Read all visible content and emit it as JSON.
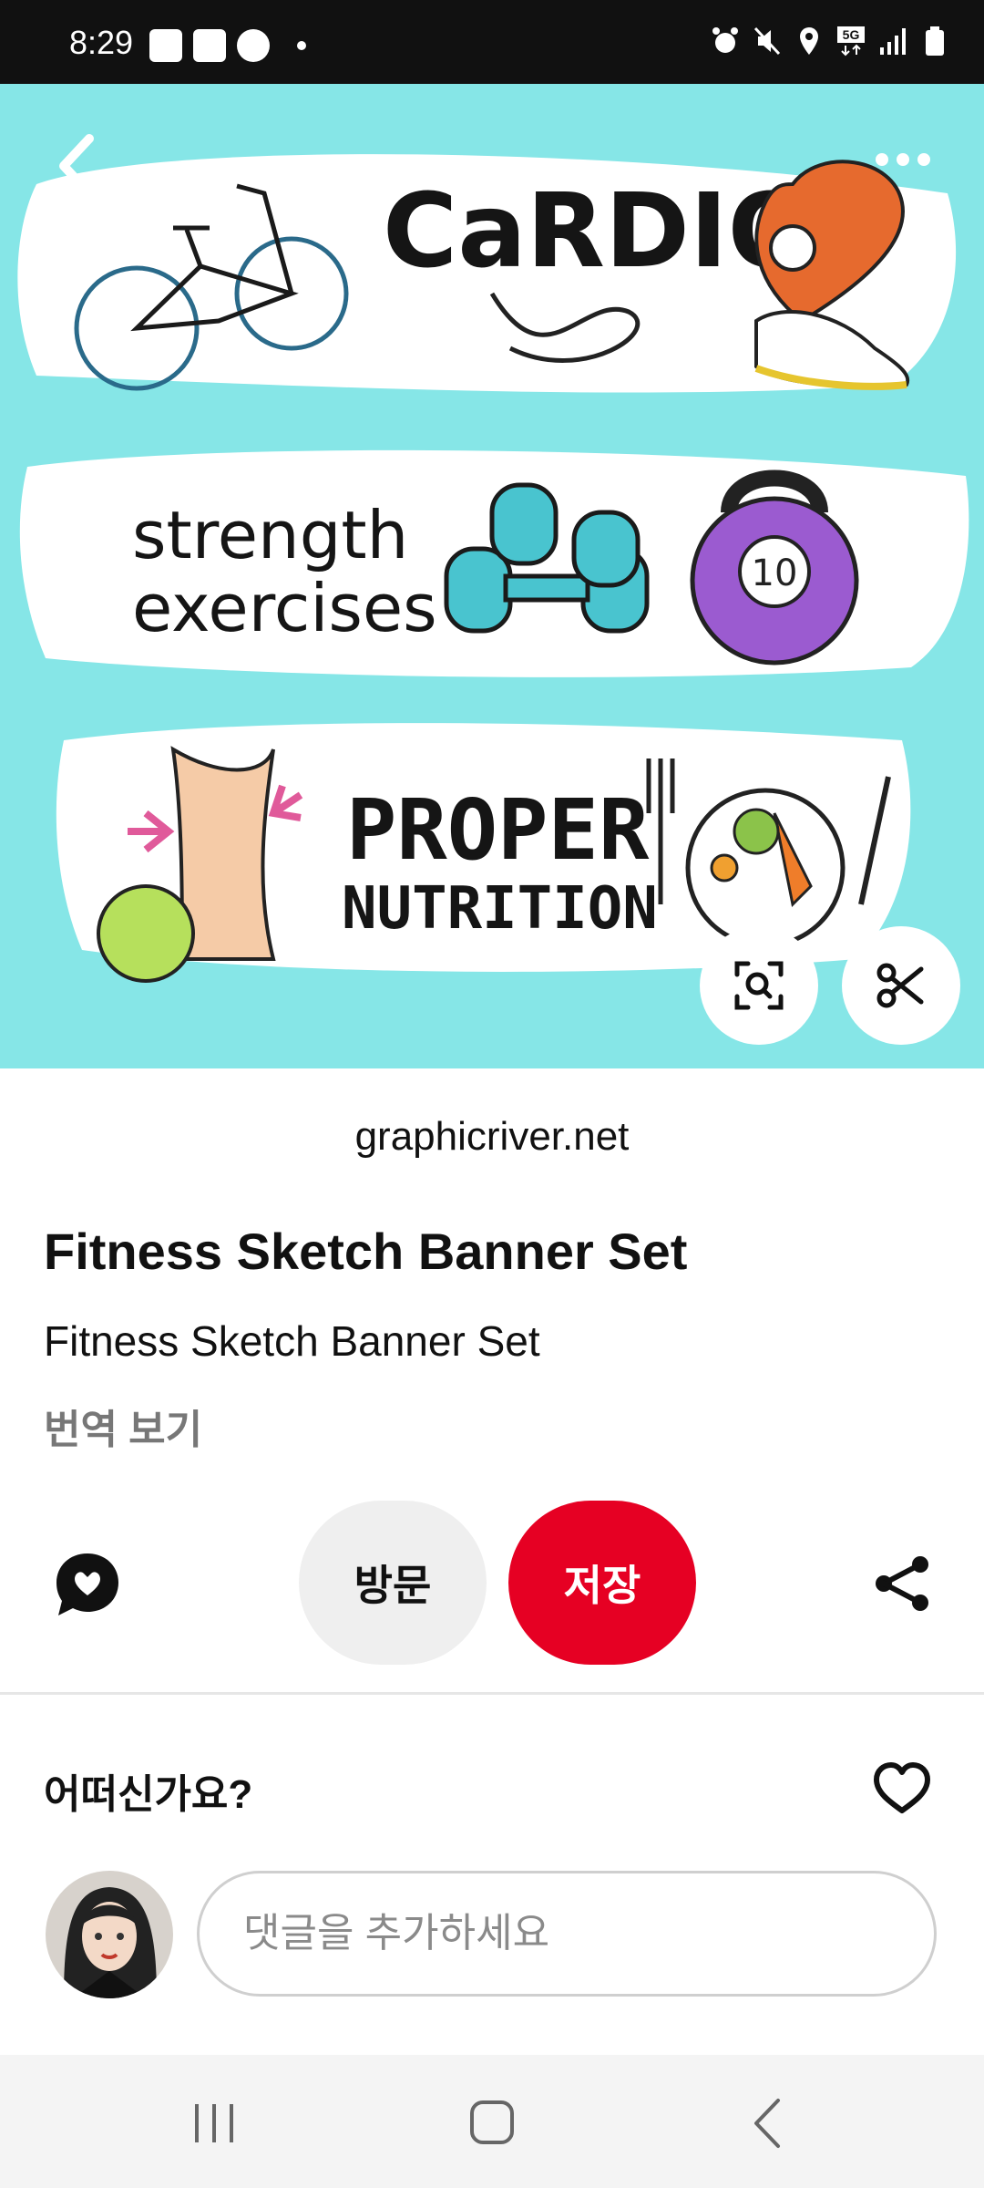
{
  "status_bar": {
    "time": "8:29",
    "left_icons": [
      "k-app-icon",
      "gallery-icon",
      "bus-icon",
      "dot"
    ],
    "right_icons": [
      "alarm-icon",
      "mute-icon",
      "location-icon",
      "5g-icon",
      "signal-icon",
      "battery-icon"
    ],
    "network": "5G"
  },
  "hero": {
    "banner_texts": [
      "CaRDIO",
      "strength",
      "exercises",
      "PROPER",
      "NUTRITION"
    ],
    "kettlebell_label": "10",
    "background_color": "#86e6e7"
  },
  "pin": {
    "source": "graphicriver.net",
    "title": "Fitness Sketch Banner Set",
    "description": "Fitness Sketch Banner Set",
    "translate_label": "번역 보기"
  },
  "actions": {
    "visit_label": "방문",
    "save_label": "저장",
    "save_color": "#e60023"
  },
  "reaction": {
    "question": "어떠신가요?"
  },
  "comment": {
    "placeholder": "댓글을 추가하세요"
  }
}
